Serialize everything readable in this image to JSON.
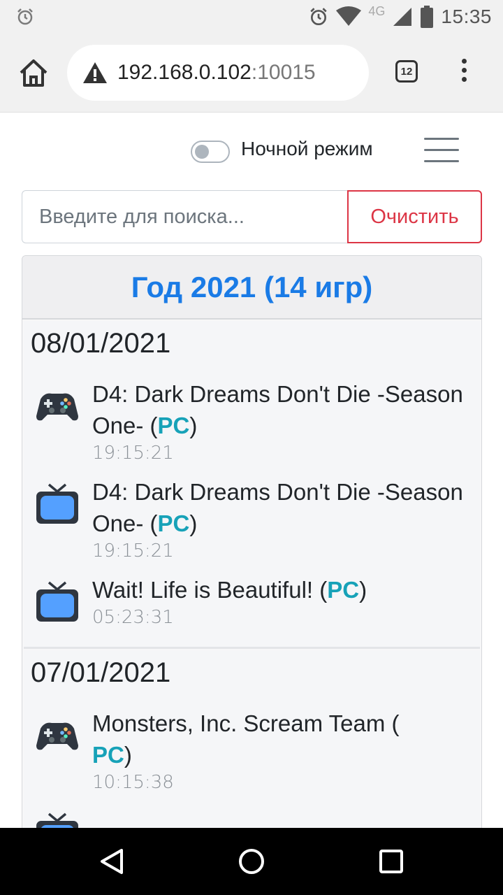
{
  "status_bar": {
    "time": "15:35",
    "network": "4G"
  },
  "browser": {
    "url_host": "192.168.0.102",
    "url_port": ":10015",
    "tab_count": "12"
  },
  "header": {
    "night_mode_label": "Ночной режим",
    "night_mode_on": false
  },
  "search": {
    "placeholder": "Введите для поиска...",
    "value": "",
    "clear_label": "Очистить"
  },
  "year_card": {
    "title": "Год 2021 (14 игр)",
    "days": [
      {
        "date": "08/01/2021",
        "entries": [
          {
            "icon": "gamepad-icon",
            "title": "D4: Dark Dreams Don't Die -Season One- (",
            "platform": "PC",
            "suffix": ")",
            "time": "19:15:21"
          },
          {
            "icon": "tv-icon",
            "title": "D4: Dark Dreams Don't Die -Season One- (",
            "platform": "PC",
            "suffix": ")",
            "time": "19:15:21"
          },
          {
            "icon": "tv-icon",
            "title": "Wait! Life is Beautiful! (",
            "platform": "PC",
            "suffix": ")",
            "time": "05:23:31"
          }
        ]
      },
      {
        "date": "07/01/2021",
        "entries": [
          {
            "icon": "gamepad-icon",
            "title": "Monsters, Inc. Scream Team (",
            "platform": "PC",
            "suffix": ")",
            "time": "10:15:38"
          }
        ]
      }
    ]
  },
  "colors": {
    "accent": "#1a7be6",
    "danger": "#dc3545",
    "platform": "#17a2b8"
  }
}
